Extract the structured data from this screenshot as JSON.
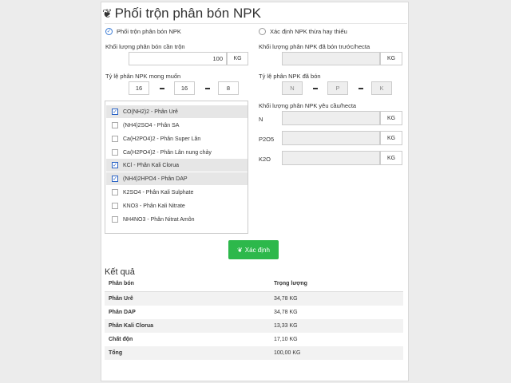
{
  "title": "Phối trộn phân bón NPK",
  "modes": {
    "mix": "Phối trộn phân bón NPK",
    "determine": "Xác định NPK thừa hay thiếu"
  },
  "left": {
    "weight_label": "Khối lượng phân bón cần trộn",
    "weight_value": "100",
    "weight_unit": "KG",
    "ratio_label": "Tỷ lệ phân NPK mong muốn",
    "ratio_n": "16",
    "ratio_p": "16",
    "ratio_k": "8"
  },
  "right": {
    "applied_label": "Khối lượng phân NPK đã bón trước/hecta",
    "applied_value": "",
    "applied_unit": "KG",
    "ratio_label": "Tỷ lệ phân NPK đã bón",
    "ratio_n_placeholder": "N",
    "ratio_p_placeholder": "P",
    "ratio_k_placeholder": "K",
    "req_label": "Khối lượng phân NPK yêu cầu/hecta",
    "rows": [
      {
        "name": "N",
        "unit": "KG"
      },
      {
        "name": "P2O5",
        "unit": "KG"
      },
      {
        "name": "K2O",
        "unit": "KG"
      }
    ]
  },
  "fertilizers": [
    {
      "label": "CO(NH2)2 - Phân Urê",
      "checked": true
    },
    {
      "label": "(NH4)2SO4 - Phân SA",
      "checked": false
    },
    {
      "label": "Ca(H2PO4)2 - Phân Super Lân",
      "checked": false
    },
    {
      "label": "Ca(H2PO4)2 - Phân Lân nung chảy",
      "checked": false
    },
    {
      "label": "KCl - Phân Kali Clorua",
      "checked": true
    },
    {
      "label": "(NH4)2HPO4 - Phân DAP",
      "checked": true
    },
    {
      "label": "K2SO4 - Phân Kali Sulphate",
      "checked": false
    },
    {
      "label": "KNO3 - Phân Kali Nitrate",
      "checked": false
    },
    {
      "label": "NH4NO3 - Phân Nitrat Amôn",
      "checked": false
    }
  ],
  "button": "Xác định",
  "result": {
    "title": "Kết quả",
    "col1": "Phân bón",
    "col2": "Trọng lượng",
    "rows": [
      {
        "name": "Phân Urê",
        "weight": "34,78 KG"
      },
      {
        "name": "Phân DAP",
        "weight": "34,78 KG"
      },
      {
        "name": "Phân Kali Clorua",
        "weight": "13,33 KG"
      },
      {
        "name": "Chất độn",
        "weight": "17,10 KG"
      },
      {
        "name": "Tổng",
        "weight": "100,00 KG"
      }
    ]
  }
}
